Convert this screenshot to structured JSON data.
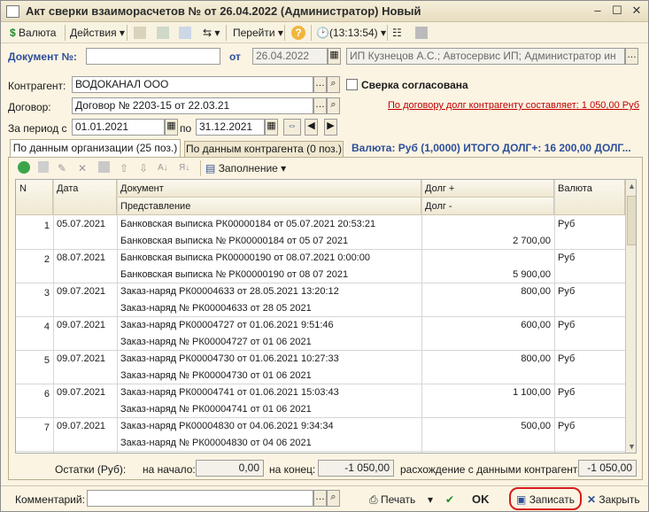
{
  "window": {
    "title": "Акт сверки взаиморасчетов №  от 26.04.2022 (Администратор) Новый"
  },
  "toolbar": {
    "currency_btn": "Валюта",
    "actions_btn": "Действия",
    "goto_btn": "Перейти",
    "time": "(13:13:54)"
  },
  "header": {
    "doc_label": "Документ №:",
    "doc_number": "",
    "date_label": "от",
    "date_value": "26.04.2022",
    "org_value": "ИП Кузнецов А.С.; Автосервис ИП; Администратор ин"
  },
  "form": {
    "counterparty_label": "Контрагент:",
    "counterparty_value": "ВОДОКАНАЛ ООО",
    "agreed_label": "Сверка согласована",
    "contract_label": "Договор:",
    "contract_value": "Договор № 2203-15  от 22.03.21",
    "debt_link": "По договору долг контрагенту составляет: 1 050,00 Руб",
    "period_label": "За период с",
    "period_from": "01.01.2021",
    "period_to_label": "по",
    "period_to": "31.12.2021"
  },
  "tabs": {
    "tab1": "По данным организации (25 поз.)",
    "tab2": "По данным контрагента (0 поз.)",
    "summary": "Валюта: Руб (1,0000)  ИТОГО ДОЛГ+: 16 200,00 ДОЛГ..."
  },
  "grid_toolbar": {
    "fill_btn": "Заполнение"
  },
  "grid": {
    "headers": {
      "n": "N",
      "date": "Дата",
      "document": "Документ",
      "representation": "Представление",
      "debt_plus": "Долг +",
      "debt_minus": "Долг -",
      "currency": "Валюта"
    },
    "rows": [
      {
        "n": "1",
        "date": "05.07.2021",
        "doc": "Банковская выписка РК00000184 от 05.07.2021 20:53:21",
        "repr": "Банковская выписка № РК00000184 от 05 07 2021",
        "plus": "",
        "minus": "2 700,00",
        "cur": "Руб"
      },
      {
        "n": "2",
        "date": "08.07.2021",
        "doc": "Банковская выписка РК00000190 от 08.07.2021 0:00:00",
        "repr": "Банковская выписка № РК00000190 от 08 07 2021",
        "plus": "",
        "minus": "5 900,00",
        "cur": "Руб"
      },
      {
        "n": "3",
        "date": "09.07.2021",
        "doc": "Заказ-наряд РК00004633 от 28.05.2021 13:20:12",
        "repr": "Заказ-наряд № РК00004633 от 28 05 2021",
        "plus": "800,00",
        "minus": "",
        "cur": "Руб"
      },
      {
        "n": "4",
        "date": "09.07.2021",
        "doc": "Заказ-наряд РК00004727 от 01.06.2021 9:51:46",
        "repr": "Заказ-наряд № РК00004727 от 01 06 2021",
        "plus": "600,00",
        "minus": "",
        "cur": "Руб"
      },
      {
        "n": "5",
        "date": "09.07.2021",
        "doc": "Заказ-наряд РК00004730 от 01.06.2021 10:27:33",
        "repr": "Заказ-наряд № РК00004730 от 01 06 2021",
        "plus": "800,00",
        "minus": "",
        "cur": "Руб"
      },
      {
        "n": "6",
        "date": "09.07.2021",
        "doc": "Заказ-наряд РК00004741 от 01.06.2021 15:03:43",
        "repr": "Заказ-наряд № РК00004741 от 01 06 2021",
        "plus": "1 100,00",
        "minus": "",
        "cur": "Руб"
      },
      {
        "n": "7",
        "date": "09.07.2021",
        "doc": "Заказ-наряд РК00004830 от 04.06.2021 9:34:34",
        "repr": "Заказ-наряд № РК00004830 от 04 06 2021",
        "plus": "500,00",
        "minus": "",
        "cur": "Руб"
      }
    ]
  },
  "totals": {
    "label": "Остатки (Руб):",
    "start_label": "на начало:",
    "start_value": "0,00",
    "end_label": "на конец:",
    "end_value": "-1 050,00",
    "diff_label": "расхождение с данными контрагента:",
    "diff_value": "-1 050,00"
  },
  "footer": {
    "comment_label": "Комментарий:",
    "comment_value": "",
    "print_btn": "Печать",
    "ok_btn": "OK",
    "save_btn": "Записать",
    "close_btn": "Закрыть"
  },
  "colors": {
    "background": "#fbf4e2",
    "highlight": "#d81b1b",
    "link": "#c00000",
    "accent_blue": "#2e4f9a"
  }
}
